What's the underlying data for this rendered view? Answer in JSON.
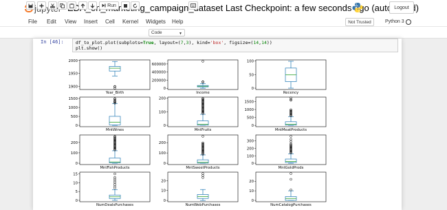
{
  "header": {
    "logo_text": "jupyter",
    "notebook_title": "EDA_on_marketing_campaign_dataset",
    "checkpoint": "Last Checkpoint: a few seconds ago",
    "autosave": "(autosaved)",
    "logout_label": "Logout"
  },
  "menu": {
    "items": [
      "File",
      "Edit",
      "View",
      "Insert",
      "Cell",
      "Kernel",
      "Widgets",
      "Help"
    ],
    "trust_label": "Not Trusted",
    "kernel_name": "Python 3"
  },
  "toolbar": {
    "run_label": "Run",
    "cell_type": "Code"
  },
  "cell": {
    "prompt": "In [46]:",
    "code": {
      "fn": "df_to_plot.plot(subplots=",
      "true1": "True",
      "mid": ", layout=(",
      "n7": "7",
      "comma": ",",
      "n3": "3",
      "mid2": "), kind=",
      "box": "'box'",
      "mid3": ", figsize=(",
      "n14a": "14",
      "n14b": "14",
      "end": "))",
      "line2": "plt.show()"
    }
  },
  "chart_data": [
    {
      "type": "box",
      "xlabel": "Year_Birth",
      "yticks": [
        "2000",
        "1950",
        "1900"
      ],
      "box": {
        "whislo": 1940,
        "q1": 1959,
        "med": 1970,
        "q3": 1977,
        "whishi": 1996
      },
      "outliers": [
        1893,
        1899,
        1900
      ]
    },
    {
      "type": "box",
      "xlabel": "Income",
      "yticks": [
        "600000",
        "400000",
        "200000",
        "0"
      ],
      "box": {
        "whislo": 1730,
        "q1": 35300,
        "med": 51380,
        "q3": 68520,
        "whishi": 113730
      },
      "outliers": [
        153900,
        157200,
        160800,
        666666
      ]
    },
    {
      "type": "box",
      "xlabel": "Recency",
      "yticks": [
        "100",
        "50",
        "0"
      ],
      "box": {
        "whislo": 0,
        "q1": 24,
        "med": 49,
        "q3": 74,
        "whishi": 99
      },
      "outliers": []
    },
    {
      "type": "box",
      "xlabel": "MntWines",
      "yticks": [
        "1500",
        "1000",
        "500",
        "0"
      ],
      "box": {
        "whislo": 0,
        "q1": 24,
        "med": 174,
        "q3": 504,
        "whishi": 1224
      },
      "outliers": [
        1240,
        1285,
        1315,
        1349,
        1394,
        1459,
        1493
      ]
    },
    {
      "type": "box",
      "xlabel": "MntFruits",
      "yticks": [
        "200",
        "100",
        "0"
      ],
      "box": {
        "whislo": 0,
        "q1": 1,
        "med": 8,
        "q3": 33,
        "whishi": 81
      },
      "outliers_range": [
        82,
        199
      ]
    },
    {
      "type": "box",
      "xlabel": "MntMeatProducts",
      "yticks": [
        "1500",
        "1000",
        "500",
        "0"
      ],
      "box": {
        "whislo": 0,
        "q1": 16,
        "med": 67,
        "q3": 232,
        "whishi": 556
      },
      "outliers_range": [
        560,
        984
      ],
      "outliers": [
        1582,
        1622,
        1725
      ]
    },
    {
      "type": "box",
      "xlabel": "MntFishProducts",
      "yticks": [
        "200",
        "100",
        "0"
      ],
      "box": {
        "whislo": 0,
        "q1": 3,
        "med": 12,
        "q3": 50,
        "whishi": 120
      },
      "outliers_range": [
        121,
        259
      ]
    },
    {
      "type": "box",
      "xlabel": "MntSweetProducts",
      "yticks": [
        "200",
        "100",
        "0"
      ],
      "box": {
        "whislo": 0,
        "q1": 1,
        "med": 8,
        "q3": 33,
        "whishi": 81
      },
      "outliers_range": [
        82,
        198
      ],
      "outliers": [
        262
      ]
    },
    {
      "type": "box",
      "xlabel": "MntGoldProds",
      "yticks": [
        "300",
        "200",
        "100",
        "0"
      ],
      "box": {
        "whislo": 0,
        "q1": 9,
        "med": 24,
        "q3": 56,
        "whishi": 126
      },
      "outliers_range": [
        127,
        249
      ],
      "outliers": [
        262,
        291,
        321,
        362
      ]
    },
    {
      "type": "box",
      "xlabel": "NumDealsPurchases",
      "yticks": [
        "15",
        "10",
        "5",
        "0"
      ],
      "box": {
        "whislo": 0,
        "q1": 1,
        "med": 2,
        "q3": 3,
        "whishi": 6
      },
      "outliers": [
        7,
        8,
        9,
        10,
        11,
        12,
        13,
        15
      ]
    },
    {
      "type": "box",
      "xlabel": "NumWebPurchases",
      "yticks": [
        "20",
        "10",
        "0"
      ],
      "box": {
        "whislo": 0,
        "q1": 2,
        "med": 4,
        "q3": 6,
        "whishi": 11
      },
      "outliers": [
        23,
        25,
        27
      ]
    },
    {
      "type": "box",
      "xlabel": "NumCatalogPurchases",
      "yticks": [
        "20",
        "10",
        "0"
      ],
      "box": {
        "whislo": 0,
        "q1": 0,
        "med": 2,
        "q3": 4,
        "whishi": 10
      },
      "outliers": [
        11,
        22,
        28
      ]
    }
  ],
  "colors": {
    "box": "#1f77b4",
    "median": "#2ca02c",
    "jupyter_orange": "#f37726",
    "prompt_blue": "#303f9f"
  }
}
